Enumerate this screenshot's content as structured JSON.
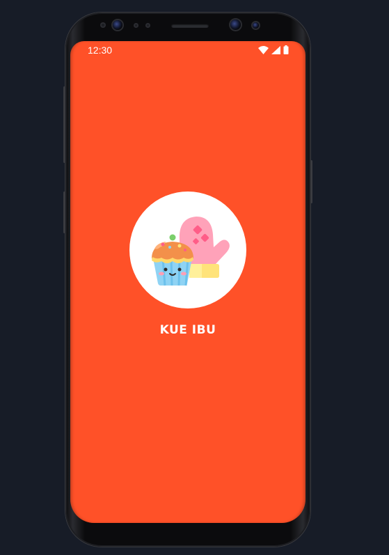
{
  "status_bar": {
    "time": "12:30",
    "icons": [
      "wifi-icon",
      "cellular-signal-icon",
      "battery-icon"
    ]
  },
  "splash": {
    "app_name": "KUE IBU",
    "logo": "cupcake-and-oven-mitt-logo",
    "background_color": "#ff5128",
    "logo_circle_color": "#ffffff",
    "title_color": "#ffffff"
  },
  "device": {
    "frame": "smartphone-mockup"
  }
}
